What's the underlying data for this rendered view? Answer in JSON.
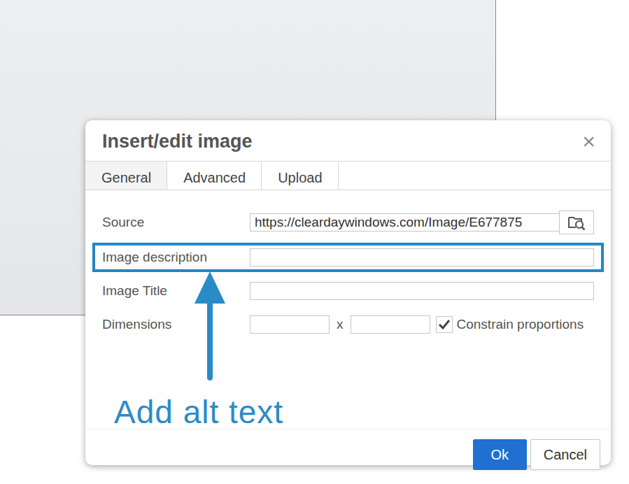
{
  "dialog": {
    "title": "Insert/edit image",
    "close": "×"
  },
  "tabs": [
    {
      "label": "General",
      "selected": true
    },
    {
      "label": "Advanced",
      "selected": false
    },
    {
      "label": "Upload",
      "selected": false
    }
  ],
  "fields": [
    {
      "kind": "url",
      "label": "Source",
      "value": "https://cleardaywindows.com/Image/E677875",
      "highlighted": false
    },
    {
      "kind": "text",
      "label": "Image description",
      "value": "",
      "highlighted": true
    },
    {
      "kind": "text",
      "label": "Image Title",
      "value": "",
      "highlighted": false
    },
    {
      "kind": "dimensions",
      "label": "Dimensions",
      "width": "",
      "height": "",
      "separator": "x",
      "highlighted": false,
      "constrain": {
        "label": "Constrain proportions",
        "checked": true
      }
    }
  ],
  "annotation": {
    "text": "Add alt text"
  },
  "buttons": [
    {
      "label": "Ok",
      "kind": "primary"
    },
    {
      "label": "Cancel",
      "kind": "secondary"
    }
  ]
}
